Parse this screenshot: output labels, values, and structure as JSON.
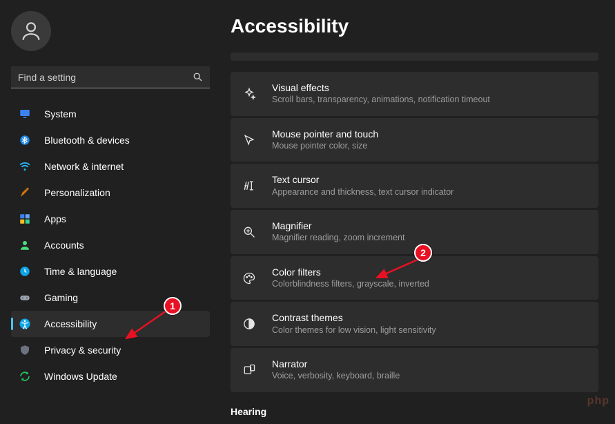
{
  "search": {
    "placeholder": "Find a setting"
  },
  "sidebar": {
    "items": [
      {
        "label": "System"
      },
      {
        "label": "Bluetooth & devices"
      },
      {
        "label": "Network & internet"
      },
      {
        "label": "Personalization"
      },
      {
        "label": "Apps"
      },
      {
        "label": "Accounts"
      },
      {
        "label": "Time & language"
      },
      {
        "label": "Gaming"
      },
      {
        "label": "Accessibility"
      },
      {
        "label": "Privacy & security"
      },
      {
        "label": "Windows Update"
      }
    ]
  },
  "main": {
    "title": "Accessibility",
    "cards": [
      {
        "title": "Visual effects",
        "desc": "Scroll bars, transparency, animations, notification timeout"
      },
      {
        "title": "Mouse pointer and touch",
        "desc": "Mouse pointer color, size"
      },
      {
        "title": "Text cursor",
        "desc": "Appearance and thickness, text cursor indicator"
      },
      {
        "title": "Magnifier",
        "desc": "Magnifier reading, zoom increment"
      },
      {
        "title": "Color filters",
        "desc": "Colorblindness filters, grayscale, inverted"
      },
      {
        "title": "Contrast themes",
        "desc": "Color themes for low vision, light sensitivity"
      },
      {
        "title": "Narrator",
        "desc": "Voice, verbosity, keyboard, braille"
      }
    ],
    "section": "Hearing"
  },
  "annotations": {
    "badge1": "1",
    "badge2": "2"
  },
  "watermark": "php"
}
